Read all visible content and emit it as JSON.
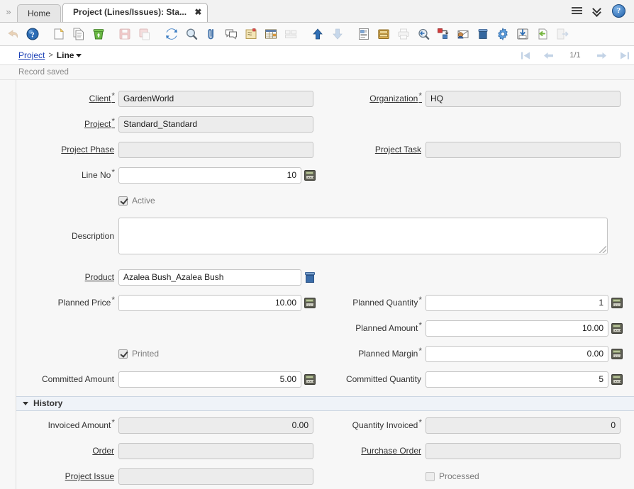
{
  "window": {
    "tabs": [
      {
        "label": "Home",
        "active": false,
        "closable": false
      },
      {
        "label": "Project (Lines/Issues): Sta...",
        "active": true,
        "closable": true
      }
    ],
    "expander_icon": "»",
    "close_glyph": "✖",
    "right_controls": {
      "menu_icon": "hamburger-menu-icon",
      "chevrons_icon": "double-chevron-down-icon",
      "help_label": "?"
    }
  },
  "toolbar": {
    "buttons": [
      {
        "name": "undo-button",
        "title": "Undo",
        "disabled": true
      },
      {
        "name": "help-button",
        "title": "Help",
        "disabled": false
      },
      {
        "name": "new-record-button",
        "title": "New Record",
        "disabled": false
      },
      {
        "name": "copy-record-button",
        "title": "Copy Record",
        "disabled": false
      },
      {
        "name": "delete-record-button",
        "title": "Delete Record",
        "disabled": false
      },
      {
        "name": "save-button",
        "title": "Save Changes",
        "disabled": true
      },
      {
        "name": "save-copy-button",
        "title": "Save and Create New",
        "disabled": true
      },
      {
        "name": "refresh-button",
        "title": "Refresh",
        "disabled": false
      },
      {
        "name": "find-button",
        "title": "Find",
        "disabled": false
      },
      {
        "name": "attachment-button",
        "title": "Attachment",
        "disabled": false
      },
      {
        "name": "chat-button",
        "title": "Chat / Notes",
        "disabled": false
      },
      {
        "name": "postit-button",
        "title": "Post It Note",
        "disabled": false
      },
      {
        "name": "grid-toggle-button",
        "title": "Toggle Grid View",
        "disabled": false
      },
      {
        "name": "multi-row-button",
        "title": "Multi Row Layout",
        "disabled": true
      },
      {
        "name": "parent-record-button",
        "title": "Parent Record",
        "disabled": false
      },
      {
        "name": "detail-record-button",
        "title": "Detail Record",
        "disabled": true
      },
      {
        "name": "report-button",
        "title": "Report",
        "disabled": false
      },
      {
        "name": "archive-button",
        "title": "Archived Documents",
        "disabled": false
      },
      {
        "name": "print-button",
        "title": "Print",
        "disabled": true
      },
      {
        "name": "zoom-across-button",
        "title": "Zoom Across",
        "disabled": false
      },
      {
        "name": "workflow-button",
        "title": "Workflow Activities",
        "disabled": false
      },
      {
        "name": "request-button",
        "title": "Requests",
        "disabled": false
      },
      {
        "name": "product-info-button",
        "title": "Product Info",
        "disabled": false
      },
      {
        "name": "settings-button",
        "title": "Preferences",
        "disabled": false
      },
      {
        "name": "export-button",
        "title": "Export Data",
        "disabled": false
      },
      {
        "name": "import-button",
        "title": "Import Data",
        "disabled": false
      },
      {
        "name": "exit-button",
        "title": "Exit",
        "disabled": true
      }
    ]
  },
  "breadcrumb": {
    "parent": "Project",
    "separator": ">",
    "current": "Line"
  },
  "navigation": {
    "first_label": "First Record",
    "prev_label": "Previous Record",
    "counter": "1/1",
    "next_label": "Next Record",
    "last_label": "Last Record"
  },
  "status": {
    "message": "Record saved"
  },
  "form": {
    "fields": {
      "client": {
        "label": "Client",
        "value": "GardenWorld",
        "required": true,
        "link": true,
        "readonly": true
      },
      "organization": {
        "label": "Organization",
        "value": "HQ",
        "required": true,
        "link": true,
        "readonly": true
      },
      "project": {
        "label": "Project",
        "value": "Standard_Standard",
        "required": true,
        "link": true,
        "readonly": true
      },
      "project_phase": {
        "label": "Project Phase",
        "value": "",
        "required": false,
        "link": true,
        "readonly": true
      },
      "project_task": {
        "label": "Project Task",
        "value": "",
        "required": false,
        "link": true,
        "readonly": true
      },
      "line_no": {
        "label": "Line No",
        "value": "10",
        "required": true,
        "link": false,
        "readonly": false
      },
      "active": {
        "label": "Active",
        "checked": true
      },
      "description": {
        "label": "Description",
        "value": "",
        "required": false,
        "link": false,
        "readonly": false
      },
      "product": {
        "label": "Product",
        "value": "Azalea Bush_Azalea Bush",
        "required": false,
        "link": true,
        "readonly": false
      },
      "planned_price": {
        "label": "Planned Price",
        "value": "10.00",
        "required": true,
        "link": false,
        "readonly": false
      },
      "planned_quantity": {
        "label": "Planned Quantity",
        "value": "1",
        "required": true,
        "link": false,
        "readonly": false
      },
      "planned_amount": {
        "label": "Planned Amount",
        "value": "10.00",
        "required": true,
        "link": false,
        "readonly": false
      },
      "printed": {
        "label": "Printed",
        "checked": true
      },
      "planned_margin": {
        "label": "Planned Margin",
        "value": "0.00",
        "required": true,
        "link": false,
        "readonly": false
      },
      "committed_amount": {
        "label": "Committed Amount",
        "value": "5.00",
        "required": false,
        "link": false,
        "readonly": false
      },
      "committed_quantity": {
        "label": "Committed Quantity",
        "value": "5",
        "required": false,
        "link": false,
        "readonly": false
      }
    }
  },
  "history": {
    "title": "History",
    "expanded": true,
    "fields": {
      "invoiced_amount": {
        "label": "Invoiced Amount",
        "value": "0.00",
        "required": true,
        "link": false,
        "readonly": true
      },
      "quantity_invoiced": {
        "label": "Quantity Invoiced",
        "value": "0",
        "required": true,
        "link": false,
        "readonly": true
      },
      "order": {
        "label": "Order",
        "value": "",
        "required": false,
        "link": true,
        "readonly": true
      },
      "purchase_order": {
        "label": "Purchase Order",
        "value": "",
        "required": false,
        "link": true,
        "readonly": true
      },
      "project_issue": {
        "label": "Project Issue",
        "value": "",
        "required": false,
        "link": true,
        "readonly": true
      },
      "processed": {
        "label": "Processed",
        "checked": false
      }
    }
  },
  "colors": {
    "link": "#1a3fb5",
    "field_bg_readonly": "#ececec",
    "field_bg_editable": "#ffffff",
    "section_bg": "#eff3f8",
    "status_text": "#8a8a8a"
  }
}
